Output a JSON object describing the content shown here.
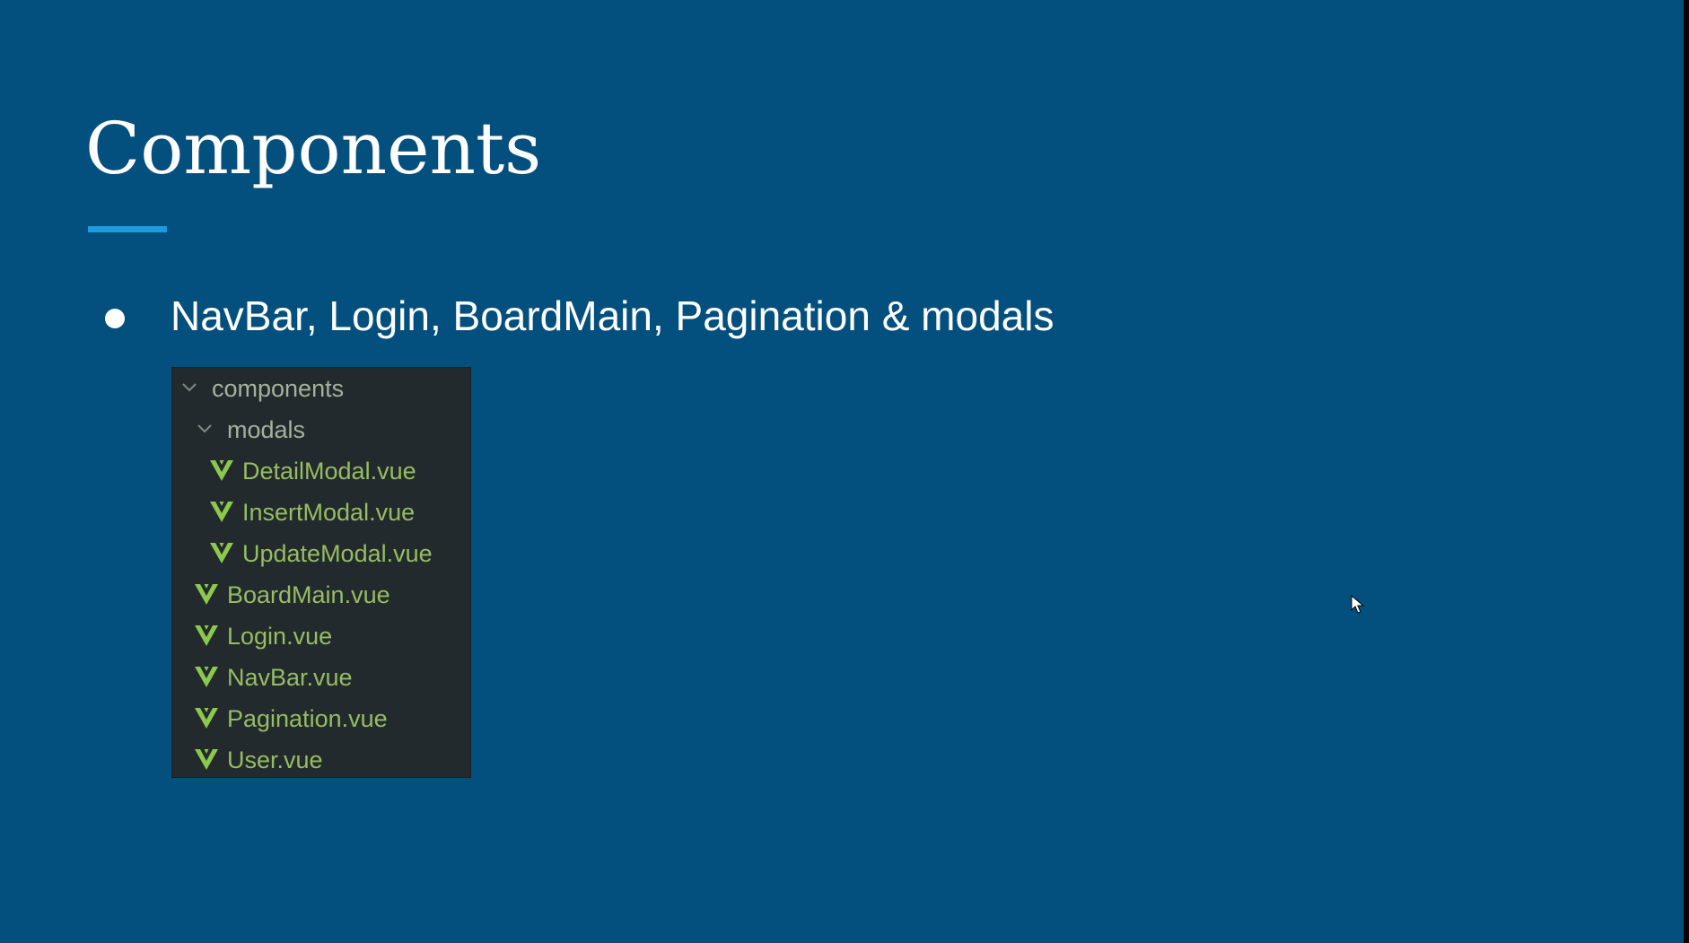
{
  "slide": {
    "title": "Components",
    "bullet_text": "NavBar, Login, BoardMain, Pagination & modals"
  },
  "explorer": {
    "items": [
      {
        "label": "components",
        "kind": "folder",
        "expanded": true,
        "depth": 0
      },
      {
        "label": "modals",
        "kind": "folder",
        "expanded": true,
        "depth": 1
      },
      {
        "label": "DetailModal.vue",
        "kind": "vue-file",
        "depth": 2
      },
      {
        "label": "InsertModal.vue",
        "kind": "vue-file",
        "depth": 2
      },
      {
        "label": "UpdateModal.vue",
        "kind": "vue-file",
        "depth": 2
      },
      {
        "label": "BoardMain.vue",
        "kind": "vue-file",
        "depth": 1
      },
      {
        "label": "Login.vue",
        "kind": "vue-file",
        "depth": 1
      },
      {
        "label": "NavBar.vue",
        "kind": "vue-file",
        "depth": 1
      },
      {
        "label": "Pagination.vue",
        "kind": "vue-file",
        "depth": 1
      },
      {
        "label": "User.vue",
        "kind": "vue-file",
        "depth": 1
      }
    ]
  },
  "icons": {
    "folder_chevron": "chevron-down-icon",
    "vue_file": "vue-logo-icon",
    "cursor": "mouse-cursor-icon"
  },
  "colors": {
    "slide_background": "#03507E",
    "title_text": "#FFFFFF",
    "title_underline": "#1D9BDF",
    "explorer_background": "#232A2D",
    "folder_label": "#A6B19C",
    "file_label": "#97BC62",
    "vue_icon": "#8CC84B"
  }
}
